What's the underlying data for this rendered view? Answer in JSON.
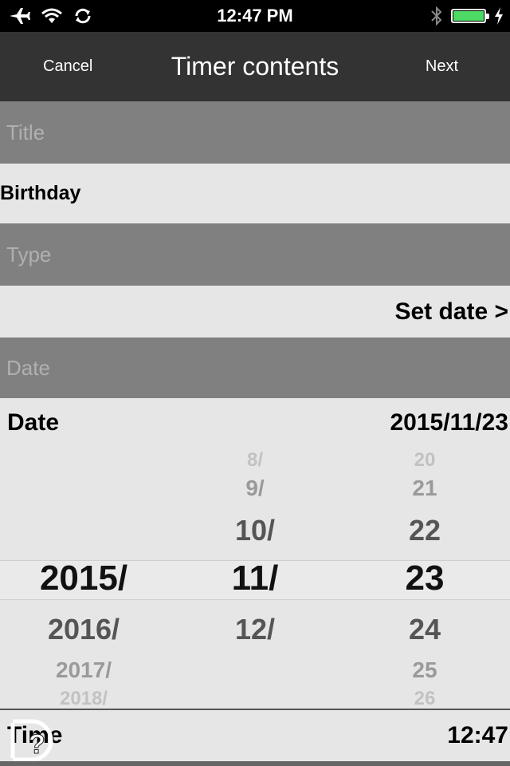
{
  "status": {
    "time": "12:47 PM",
    "battery_level": 1.0
  },
  "nav": {
    "cancel": "Cancel",
    "title": "Timer contents",
    "next": "Next"
  },
  "sections": {
    "title_header": "Title",
    "title_value": "Birthday",
    "type_header": "Type",
    "set_date": "Set date >",
    "date_header": "Date"
  },
  "date": {
    "label": "Date",
    "value": "2015/11/23"
  },
  "picker": {
    "years": {
      "selected": "2015/",
      "next1": "2016/",
      "next2": "2017/",
      "next3": "2018/"
    },
    "months": {
      "prev3": "8/",
      "prev2": "9/",
      "prev1": "10/",
      "selected": "11/",
      "next1": "12/"
    },
    "days": {
      "prev3": "20",
      "prev2": "21",
      "prev1": "22",
      "selected": "23",
      "next1": "24",
      "next2": "25",
      "next3": "26"
    }
  },
  "time": {
    "label": "Time",
    "value": "12:47"
  },
  "icons": {
    "airplane": "airplane-icon",
    "wifi": "wifi-icon",
    "sync": "sync-icon",
    "bluetooth": "bluetooth-icon",
    "battery": "battery-icon",
    "charging": "charging-icon",
    "help": "help-icon"
  },
  "colors": {
    "nav_bg": "#333333",
    "section_bg": "#808080",
    "row_bg": "#e6e6e6",
    "battery_fill": "#4cd964"
  }
}
